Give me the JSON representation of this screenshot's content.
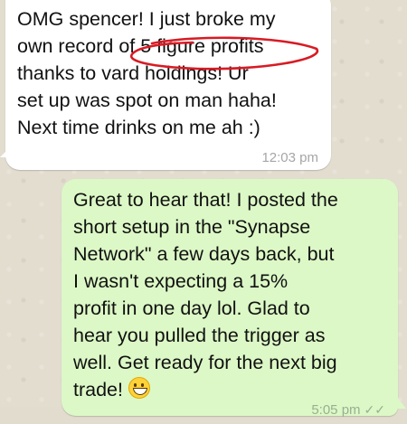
{
  "messages": [
    {
      "direction": "incoming",
      "lines": [
        "OMG spencer! I just broke my",
        "own record of 5 figure profits",
        "thanks to vard holdings! Ur",
        "set up was spot on man haha!",
        "Next time drinks on me ah :)"
      ],
      "time": "12:03 pm"
    },
    {
      "direction": "outgoing",
      "lines": [
        "Great to hear that! I posted the",
        "short setup in the \"Synapse",
        "Network\" a few days back, but",
        "I wasn't expecting a 15%",
        "profit in one day lol. Glad to",
        "hear you pulled the trigger as",
        "well. Get ready for the next big",
        "trade!"
      ],
      "time": "5:05 pm",
      "emoji": "grinning-face-emoji",
      "status_icon": "double-check-icon"
    }
  ],
  "colors": {
    "incoming_bubble": "#ffffff",
    "outgoing_bubble": "#dcf8c6",
    "annotation_circle": "#d81b24",
    "chat_background": "#e3ddd0"
  }
}
